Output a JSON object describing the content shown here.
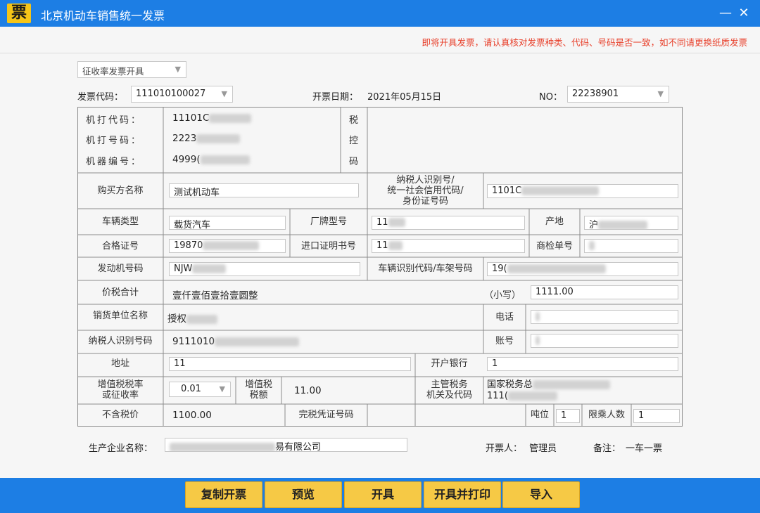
{
  "window": {
    "title": "北京机动车销售统一发票",
    "app_icon_glyph": "票"
  },
  "notice": "即将开具发票，请认真核对发票种类、代码、号码是否一致，如不同请更换纸质发票",
  "mode_select": {
    "value": "征收率发票开具"
  },
  "header": {
    "code_label": "发票代码：",
    "code_value": "111010100027",
    "date_label": "开票日期：",
    "date_value": "2021年05月15日",
    "no_label": "NO：",
    "no_value": "22238901"
  },
  "machine": {
    "code_label": "机打代码：",
    "code_value": "11101C",
    "number_label": "机打号码：",
    "number_value": "2223",
    "device_label": "机器编号：",
    "device_value": "4999(",
    "tax_control": [
      "税",
      "控",
      "码"
    ]
  },
  "fields": {
    "buyer_name_label": "购买方名称",
    "buyer_name_value": "测试机动车",
    "taxpayer_id_label": "纳税人识别号/\n统一社会信用代码/\n身份证号码",
    "taxpayer_id_value": "1101C",
    "vehicle_type_label": "车辆类型",
    "vehicle_type_value": "载货汽车",
    "brand_model_label": "厂牌型号",
    "brand_model_value": "11",
    "origin_label": "产地",
    "origin_value": "沪",
    "cert_label": "合格证号",
    "cert_value": "19870",
    "import_cert_label": "进口证明书号",
    "import_cert_value": "11",
    "inspection_label": "商检单号",
    "inspection_value": "",
    "engine_label": "发动机号码",
    "engine_value": "NJW",
    "vin_label": "车辆识别代码/车架号码",
    "vin_value": "19(",
    "total_label": "价税合计",
    "total_words": "壹仟壹佰壹拾壹圆整",
    "total_small_label": "（小写）",
    "total_small_value": "1111.00",
    "seller_name_label": "销货单位名称",
    "seller_name_value": "授权",
    "phone_label": "电话",
    "phone_value": "",
    "seller_tax_label": "纳税人识别号码",
    "seller_tax_value": "9111010",
    "account_label": "账号",
    "account_value": "",
    "address_label": "地址",
    "address_value": "11",
    "bank_label": "开户银行",
    "bank_value": "1",
    "vat_rate_label": "增值税税率\n或征收率",
    "vat_rate_value": "0.01",
    "vat_amount_label": "增值税\n税额",
    "vat_amount_value": "11.00",
    "tax_authority_label": "主管税务\n机关及代码",
    "tax_authority_line1": "国家税务总",
    "tax_authority_line2": "111(",
    "pretax_label": "不含税价",
    "pretax_value": "1100.00",
    "tax_receipt_label": "完税凭证号码",
    "tax_receipt_value": "",
    "tonnage_label": "吨位",
    "tonnage_value": "1",
    "passengers_label": "限乘人数",
    "passengers_value": "1"
  },
  "footer": {
    "manufacturer_label": "生产企业名称：",
    "manufacturer_value": "易有限公司",
    "issuer_label": "开票人：",
    "issuer_value": "管理员",
    "remark_label": "备注：",
    "remark_value": "一车一票"
  },
  "buttons": [
    "复制开票",
    "预览",
    "开具",
    "开具并打印",
    "导入"
  ],
  "colors": {
    "titlebar": "#1d7ee4",
    "button": "#f6c945",
    "notice": "#e8402b",
    "app_icon": "#f5c518"
  }
}
